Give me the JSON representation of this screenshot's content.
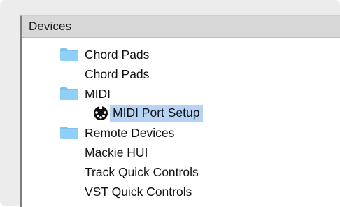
{
  "panel": {
    "header": "Devices"
  },
  "tree": {
    "items": [
      {
        "label": "Chord Pads",
        "icon": "folder-icon"
      },
      {
        "label": "Chord Pads",
        "icon": null
      },
      {
        "label": "MIDI",
        "icon": "folder-icon"
      },
      {
        "label": "MIDI Port Setup",
        "icon": "midi-connector-icon",
        "selected": true
      },
      {
        "label": "Remote Devices",
        "icon": "folder-icon"
      },
      {
        "label": "Mackie HUI",
        "icon": null
      },
      {
        "label": "Track Quick Controls",
        "icon": null
      },
      {
        "label": "VST Quick Controls",
        "icon": null
      }
    ]
  },
  "colors": {
    "header_bg": "#d7d7d7",
    "selection": "#b6d3f5",
    "folder": "#7cc3ef"
  }
}
